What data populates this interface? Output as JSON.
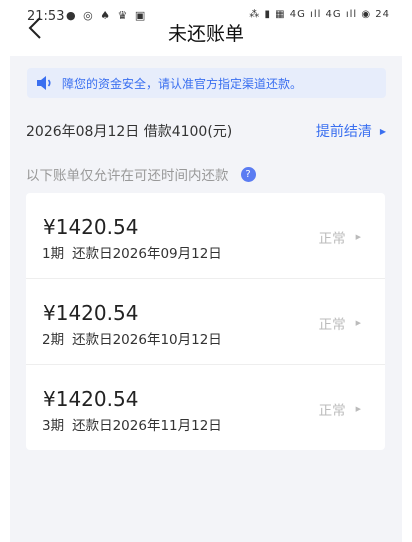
{
  "status_bar": {
    "time": "21:53",
    "notifications": "● ◎ ♠ ♛ ▣",
    "indicators": "⁂ ▮ ▦ 4G ıll 4G ıll ◉ 24"
  },
  "nav": {
    "title": "未还账单"
  },
  "notice": {
    "text": "障您的资金安全，请认准官方指定渠道还款。"
  },
  "loan": {
    "info": "2026年08月12日 借款4100(元)",
    "prepay_label": "提前结清",
    "prepay_arrow": "▶"
  },
  "hint": {
    "text": "以下账单仅允许在可还时间内还款",
    "help_icon": "?"
  },
  "bills": [
    {
      "amount": "¥1420.54",
      "period": "1期",
      "due": "还款日2026年09月12日",
      "status": "正常",
      "arrow": "▶"
    },
    {
      "amount": "¥1420.54",
      "period": "2期",
      "due": "还款日2026年10月12日",
      "status": "正常",
      "arrow": "▶"
    },
    {
      "amount": "¥1420.54",
      "period": "3期",
      "due": "还款日2026年11月12日",
      "status": "正常",
      "arrow": "▶"
    }
  ],
  "colors": {
    "accent": "#3a6ff0",
    "page_bg": "#f3f4f8",
    "notice_bg": "#e7edfb",
    "muted": "#bbbbbb"
  }
}
